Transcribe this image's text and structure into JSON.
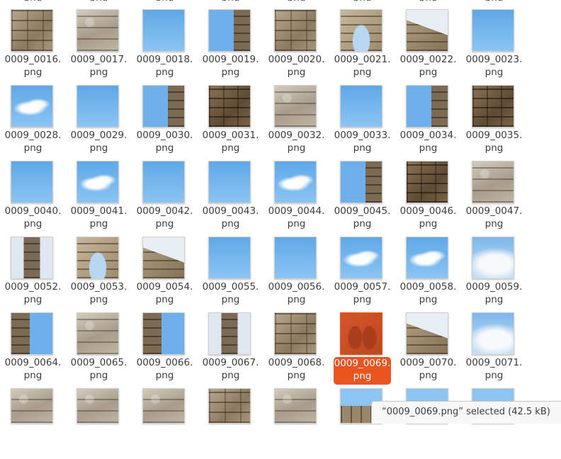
{
  "files": [
    {
      "name": "0009_0016.\npng",
      "thumb": "stone"
    },
    {
      "name": "0009_0017.\npng",
      "thumb": "granite"
    },
    {
      "name": "0009_0018.\npng",
      "thumb": "sky"
    },
    {
      "name": "0009_0019.\npng",
      "thumb": "sky-right-stone"
    },
    {
      "name": "0009_0020.\npng",
      "thumb": "stone"
    },
    {
      "name": "0009_0021.\npng",
      "thumb": "arch"
    },
    {
      "name": "0009_0022.\npng",
      "thumb": "stone-sky"
    },
    {
      "name": "0009_0023.\npng",
      "thumb": "sky"
    },
    {
      "name": "0009_0028.\npng",
      "thumb": "cloud"
    },
    {
      "name": "0009_0029.\npng",
      "thumb": "sky"
    },
    {
      "name": "0009_0030.\npng",
      "thumb": "sky-right-stone"
    },
    {
      "name": "0009_0031.\npng",
      "thumb": "stone-dark"
    },
    {
      "name": "0009_0032.\npng",
      "thumb": "granite"
    },
    {
      "name": "0009_0033.\npng",
      "thumb": "sky"
    },
    {
      "name": "0009_0034.\npng",
      "thumb": "sky-right-stone"
    },
    {
      "name": "0009_0035.\npng",
      "thumb": "stone-dark"
    },
    {
      "name": "0009_0040.\npng",
      "thumb": "sky"
    },
    {
      "name": "0009_0041.\npng",
      "thumb": "cloud"
    },
    {
      "name": "0009_0042.\npng",
      "thumb": "sky"
    },
    {
      "name": "0009_0043.\npng",
      "thumb": "sky"
    },
    {
      "name": "0009_0044.\npng",
      "thumb": "cloud"
    },
    {
      "name": "0009_0045.\npng",
      "thumb": "sky-right-stone"
    },
    {
      "name": "0009_0046.\npng",
      "thumb": "stone-dark"
    },
    {
      "name": "0009_0047.\npng",
      "thumb": "granite"
    },
    {
      "name": "0009_0052.\npng",
      "thumb": "pillar"
    },
    {
      "name": "0009_0053.\npng",
      "thumb": "arch"
    },
    {
      "name": "0009_0054.\npng",
      "thumb": "stone-sky"
    },
    {
      "name": "0009_0055.\npng",
      "thumb": "sky"
    },
    {
      "name": "0009_0056.\npng",
      "thumb": "sky"
    },
    {
      "name": "0009_0057.\npng",
      "thumb": "cloud"
    },
    {
      "name": "0009_0058.\npng",
      "thumb": "cloud"
    },
    {
      "name": "0009_0059.\npng",
      "thumb": "cloudy"
    },
    {
      "name": "0009_0064.\npng",
      "thumb": "sky-left-stone"
    },
    {
      "name": "0009_0065.\npng",
      "thumb": "granite"
    },
    {
      "name": "0009_0066.\npng",
      "thumb": "sky-left-stone"
    },
    {
      "name": "0009_0067.\npng",
      "thumb": "pillar"
    },
    {
      "name": "0009_0068.\npng",
      "thumb": "stone"
    },
    {
      "name": "0009_0069.\npng",
      "thumb": "red-arch",
      "selected": true
    },
    {
      "name": "0009_0070.\npng",
      "thumb": "stone-sky"
    },
    {
      "name": "0009_0071.\npng",
      "thumb": "cloudy"
    },
    {
      "name": "",
      "thumb": "granite"
    },
    {
      "name": "",
      "thumb": "granite"
    },
    {
      "name": "",
      "thumb": "granite"
    },
    {
      "name": "",
      "thumb": "stone"
    },
    {
      "name": "",
      "thumb": "granite"
    },
    {
      "name": "",
      "thumb": "sky-bottom-stone"
    },
    {
      "name": "",
      "thumb": "sky-bottom-stone"
    },
    {
      "name": "",
      "thumb": "sky-bottom-stone"
    }
  ],
  "top_partial_labels": [
    "png",
    "png",
    "png",
    "png",
    "png",
    "png",
    "png",
    "png"
  ],
  "status": {
    "text": "“0009_0069.png” selected  (42.5 kB)"
  }
}
